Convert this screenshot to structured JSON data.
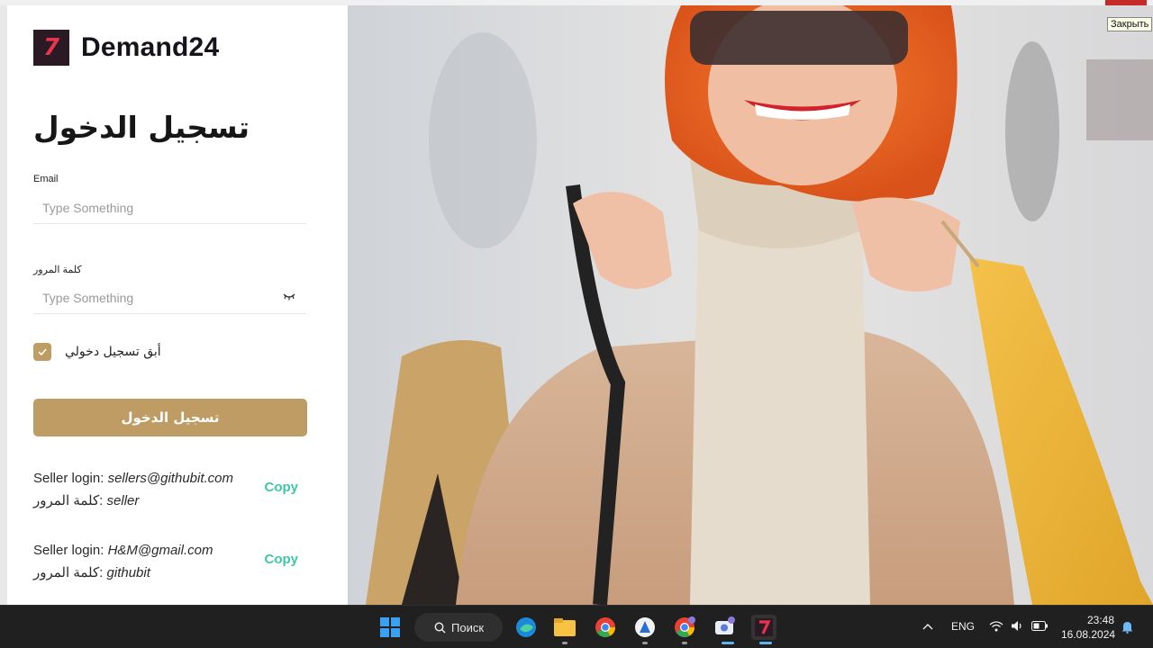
{
  "brand": {
    "name": "Demand24",
    "logo_glyph": "7"
  },
  "login": {
    "title": "تسجيل الدخول",
    "email_label": "Email",
    "email_placeholder": "Type Something",
    "password_label": "كلمة المرور",
    "password_placeholder": "Type Something",
    "remember_label": "أبق تسجيل دخولي",
    "remember_checked": true,
    "submit_label": "تسجيل الدخول"
  },
  "credentials": [
    {
      "login_label": "Seller login:",
      "login_value": "sellers@githubit.com",
      "password_label": "كلمة المرور:",
      "password_value": "seller",
      "copy_label": "Copy"
    },
    {
      "login_label": "Seller login:",
      "login_value": "H&M@gmail.com",
      "password_label": "كلمة المرور:",
      "password_value": "githubit",
      "copy_label": "Copy"
    }
  ],
  "tooltip": {
    "text": "Закрыть"
  },
  "taskbar": {
    "search_label": "Поиск",
    "language": "ENG",
    "time": "23:48",
    "date": "16.08.2024",
    "apps": [
      "windows-start-icon",
      "edge-icon",
      "file-explorer-icon",
      "chrome-icon",
      "vpn-app-icon",
      "chrome-profile-icon",
      "camera-app-icon",
      "demand24-app-icon"
    ]
  },
  "colors": {
    "accent": "#bf9c64",
    "copy": "#3ec7a5",
    "brand_dark": "#2b1a24",
    "brand_red": "#e8344e"
  }
}
